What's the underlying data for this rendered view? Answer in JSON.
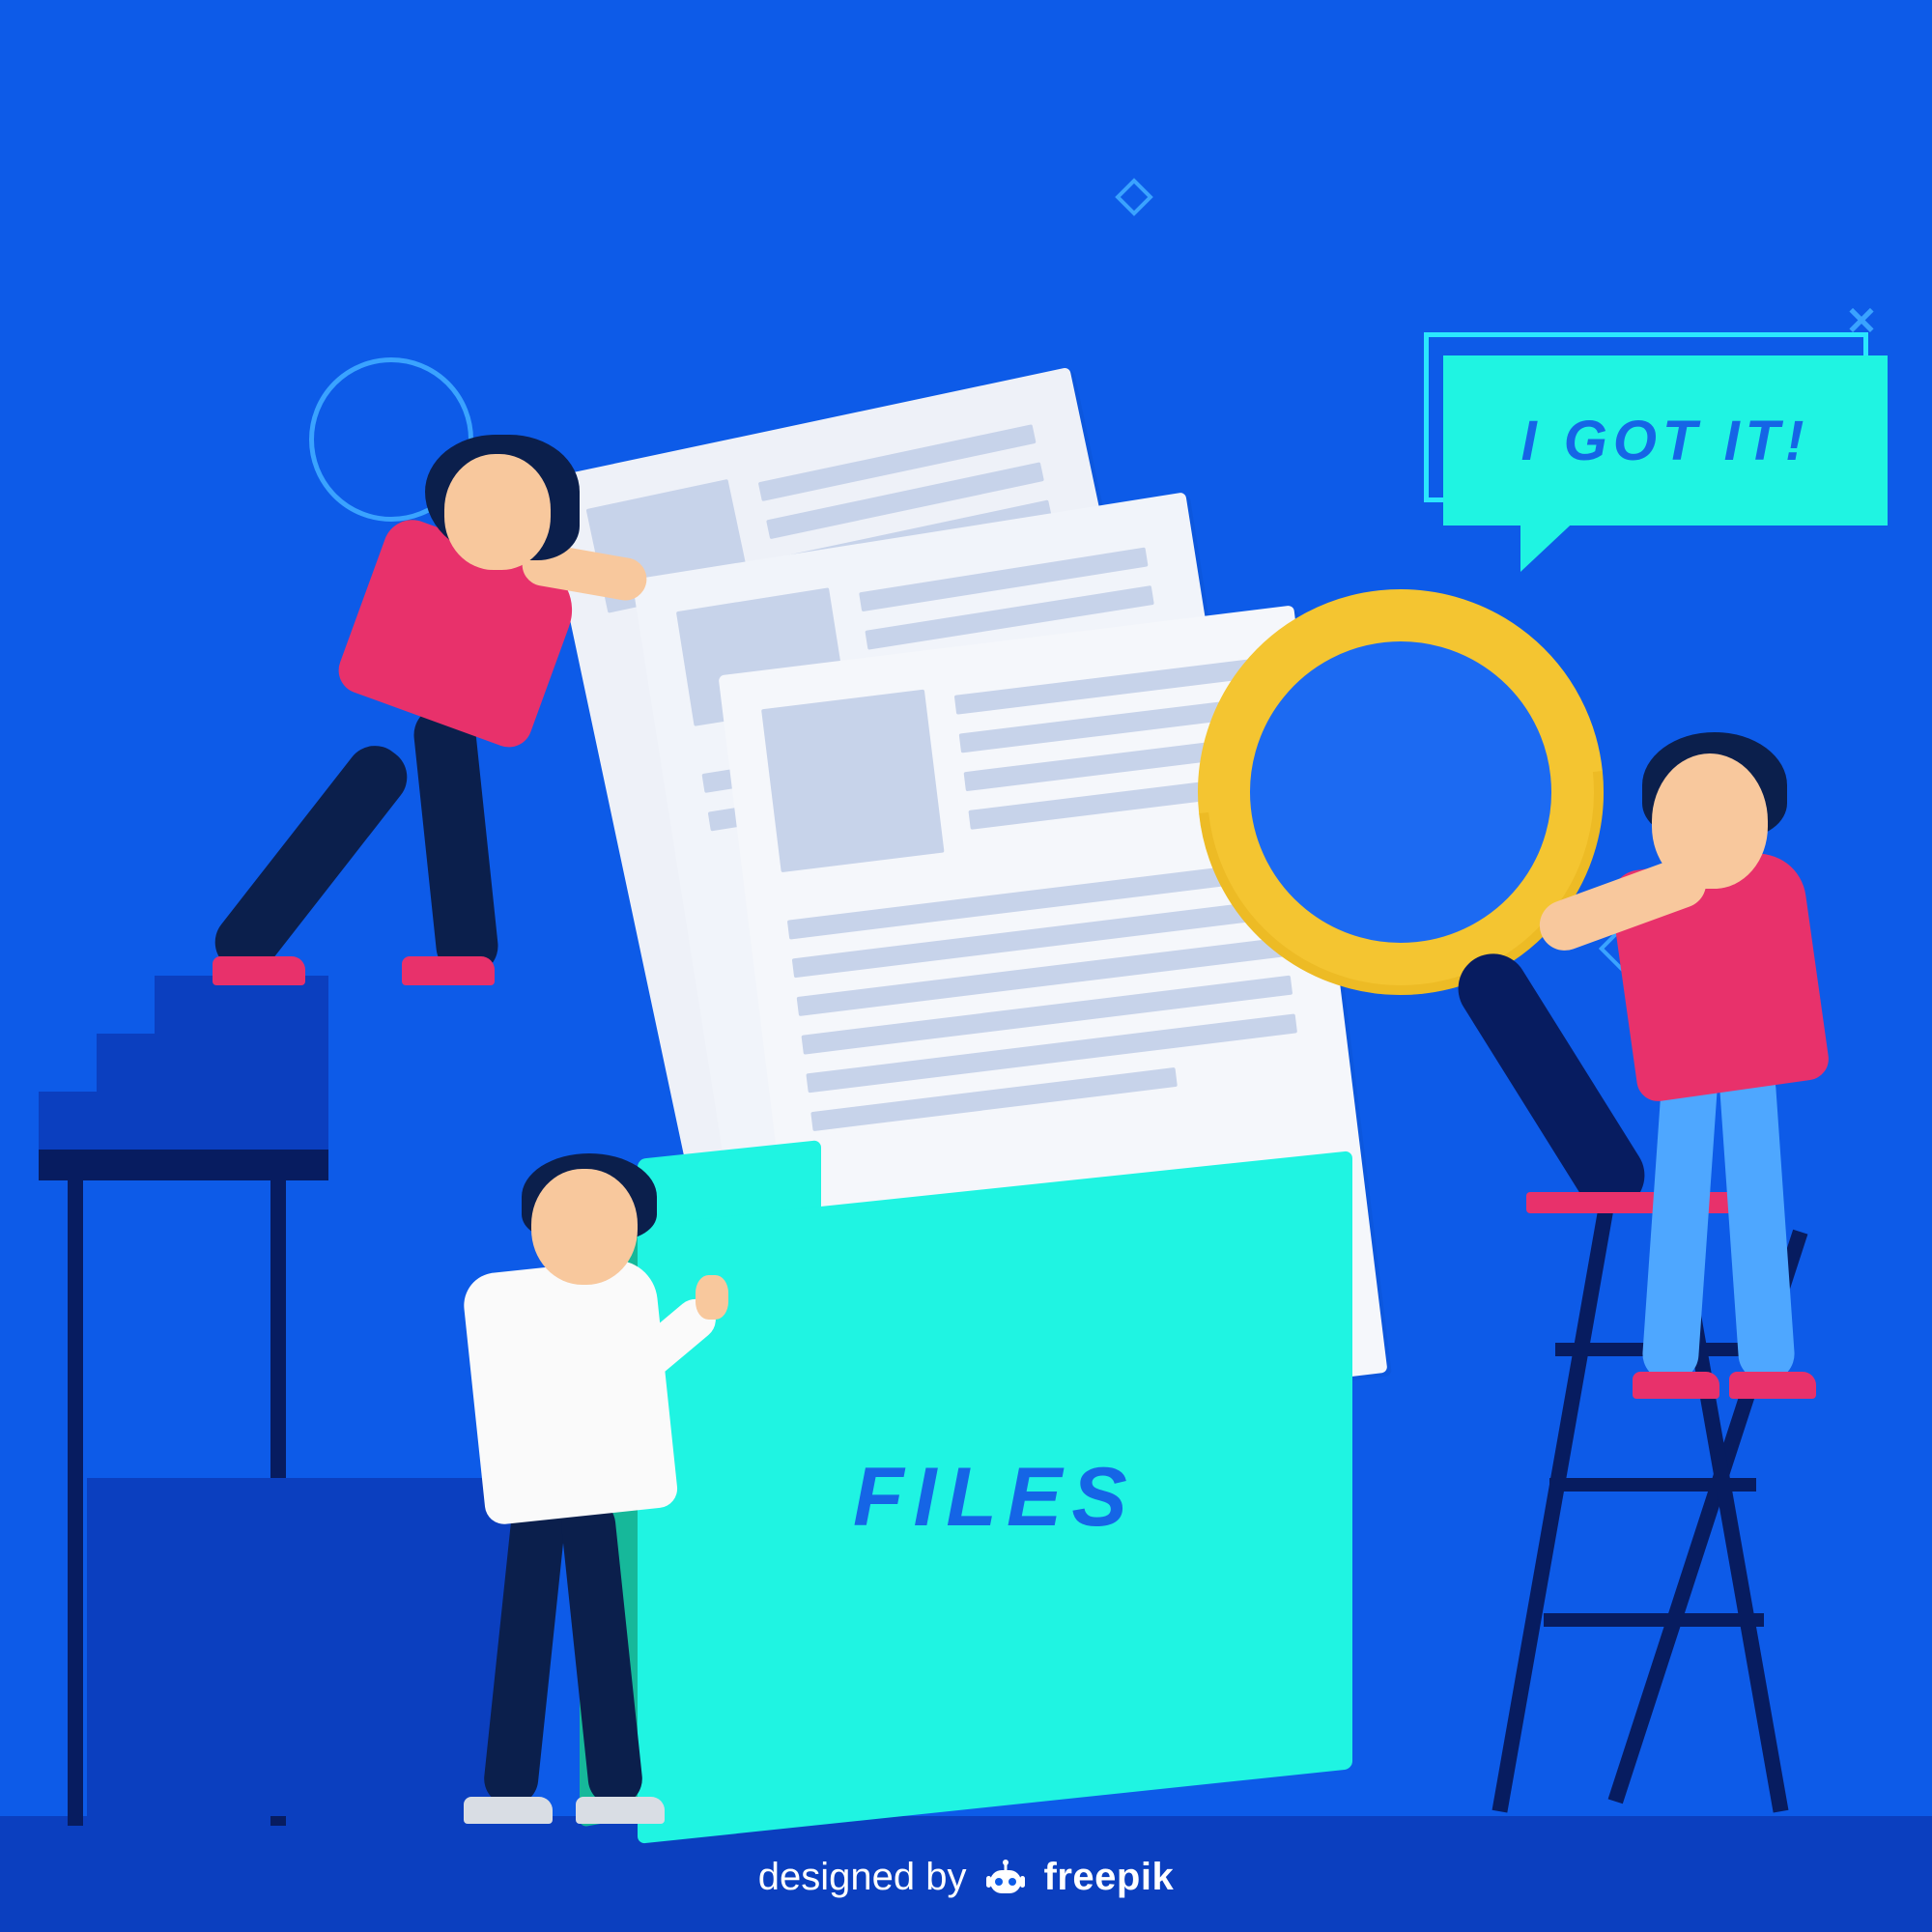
{
  "speech": {
    "text": "I GOT IT!"
  },
  "folder": {
    "label": "FILES"
  },
  "attribution": {
    "prefix": "designed by",
    "brand": "freepik"
  },
  "colors": {
    "background": "#0d5be8",
    "floor": "#0b3fbf",
    "folder_front": "#1ff4e2",
    "folder_back": "#16b89a",
    "accent_blue": "#1565e6",
    "accent_pink": "#e8316b",
    "accent_yellow": "#f4c531",
    "dark_navy": "#071c60"
  }
}
